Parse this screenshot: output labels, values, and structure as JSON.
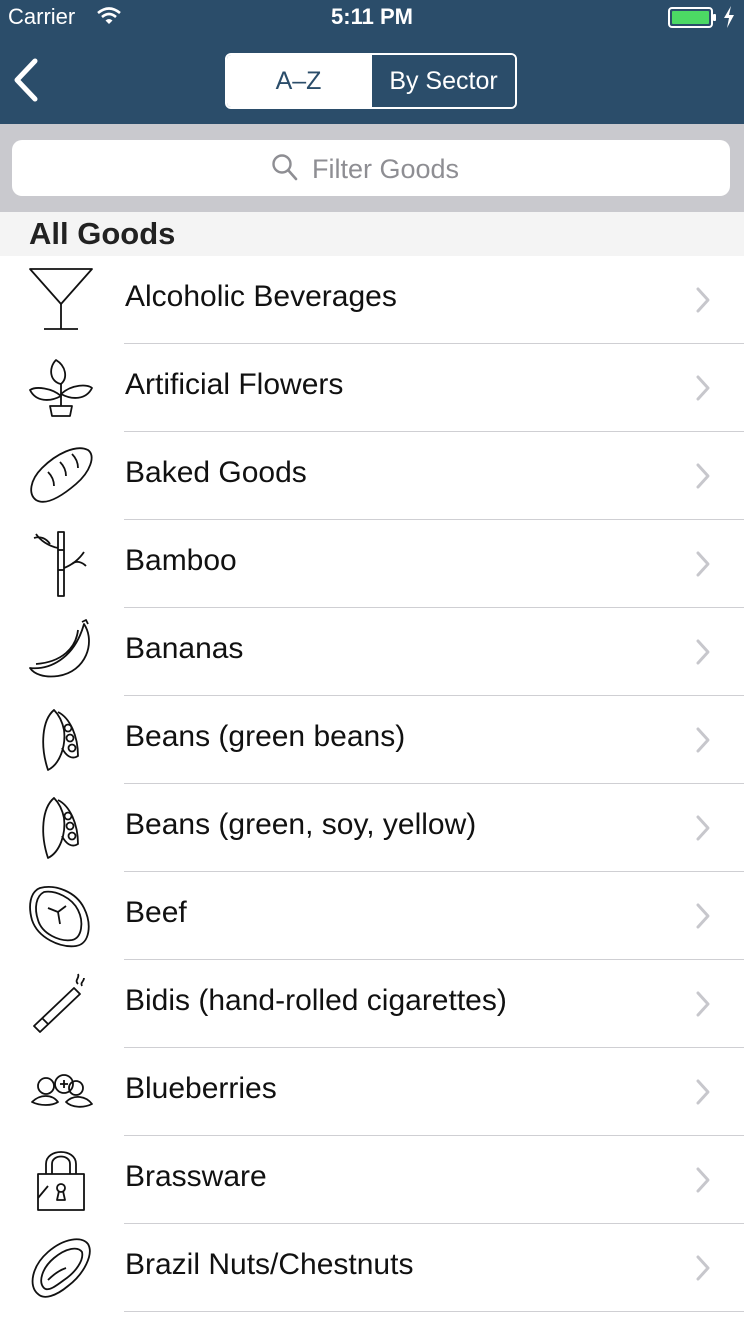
{
  "status_bar": {
    "carrier": "Carrier",
    "time": "5:11 PM",
    "icons": [
      "wifi-icon",
      "battery-icon",
      "charging-bolt-icon"
    ],
    "battery_color": "#4cd964"
  },
  "nav": {
    "back_icon": "chevron-left-icon",
    "segments": [
      {
        "label": "A–Z",
        "selected": true
      },
      {
        "label": "By Sector",
        "selected": false
      }
    ],
    "bar_color": "#2b4d6a"
  },
  "search": {
    "placeholder": "Filter Goods",
    "value": "",
    "icon": "search-icon"
  },
  "section": {
    "title": "All Goods"
  },
  "items": [
    {
      "label": "Alcoholic Beverages",
      "icon": "cocktail-glass-icon"
    },
    {
      "label": "Artificial Flowers",
      "icon": "potted-plant-icon"
    },
    {
      "label": "Baked Goods",
      "icon": "bread-loaf-icon"
    },
    {
      "label": "Bamboo",
      "icon": "bamboo-icon"
    },
    {
      "label": "Bananas",
      "icon": "banana-icon"
    },
    {
      "label": "Beans (green beans)",
      "icon": "bean-pod-icon"
    },
    {
      "label": "Beans (green, soy, yellow)",
      "icon": "bean-pod-icon"
    },
    {
      "label": "Beef",
      "icon": "steak-icon"
    },
    {
      "label": "Bidis (hand-rolled cigarettes)",
      "icon": "cigarette-icon"
    },
    {
      "label": "Blueberries",
      "icon": "blueberries-icon"
    },
    {
      "label": "Brassware",
      "icon": "padlock-icon"
    },
    {
      "label": "Brazil Nuts/Chestnuts",
      "icon": "nut-icon"
    }
  ]
}
